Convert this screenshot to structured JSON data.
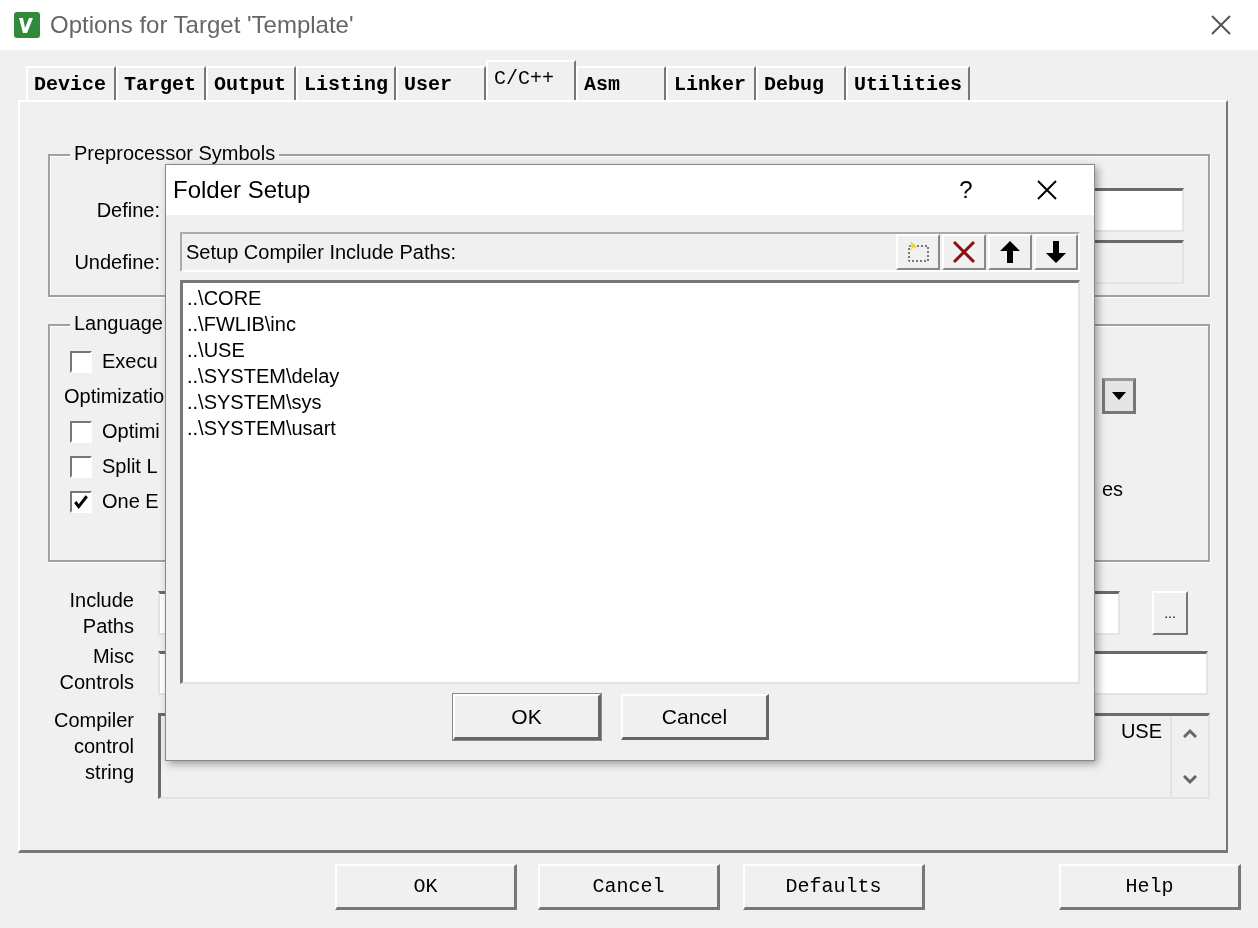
{
  "window": {
    "title": "Options for Target 'Template'"
  },
  "tabs": [
    {
      "label": "Device",
      "selected": false
    },
    {
      "label": "Target",
      "selected": false
    },
    {
      "label": "Output",
      "selected": false
    },
    {
      "label": "Listing",
      "selected": false
    },
    {
      "label": "User",
      "selected": false
    },
    {
      "label": "C/C++",
      "selected": true
    },
    {
      "label": "Asm",
      "selected": false
    },
    {
      "label": "Linker",
      "selected": false
    },
    {
      "label": "Debug",
      "selected": false
    },
    {
      "label": "Utilities",
      "selected": false
    }
  ],
  "preprocessor": {
    "title": "Preprocessor Symbols",
    "define_label": "Define:",
    "undefine_label": "Undefine:"
  },
  "language": {
    "title": "Language",
    "items": [
      {
        "kind": "checkbox",
        "label": "Execu",
        "checked": false
      },
      {
        "kind": "label",
        "label": "Optimizatio"
      },
      {
        "kind": "checkbox",
        "label": "Optimi",
        "checked": false
      },
      {
        "kind": "checkbox",
        "label": "Split L",
        "checked": false
      },
      {
        "kind": "checkbox",
        "label": "One E",
        "checked": true
      }
    ],
    "right_text": "es"
  },
  "include_paths": {
    "label": "Include Paths",
    "browse": "..."
  },
  "misc_controls": {
    "label": "Misc Controls"
  },
  "compiler_string": {
    "label": "Compiler control string",
    "lines": [
      "USE"
    ]
  },
  "buttons": [
    "OK",
    "Cancel",
    "Defaults",
    "Help"
  ],
  "folder_setup": {
    "title": "Folder Setup",
    "help": "?",
    "list_label": "Setup Compiler Include Paths:",
    "paths": [
      "..\\CORE",
      "..\\FWLIB\\inc",
      "..\\USE",
      "..\\SYSTEM\\delay",
      "..\\SYSTEM\\sys",
      "..\\SYSTEM\\usart"
    ],
    "buttons": [
      "OK",
      "Cancel"
    ]
  }
}
